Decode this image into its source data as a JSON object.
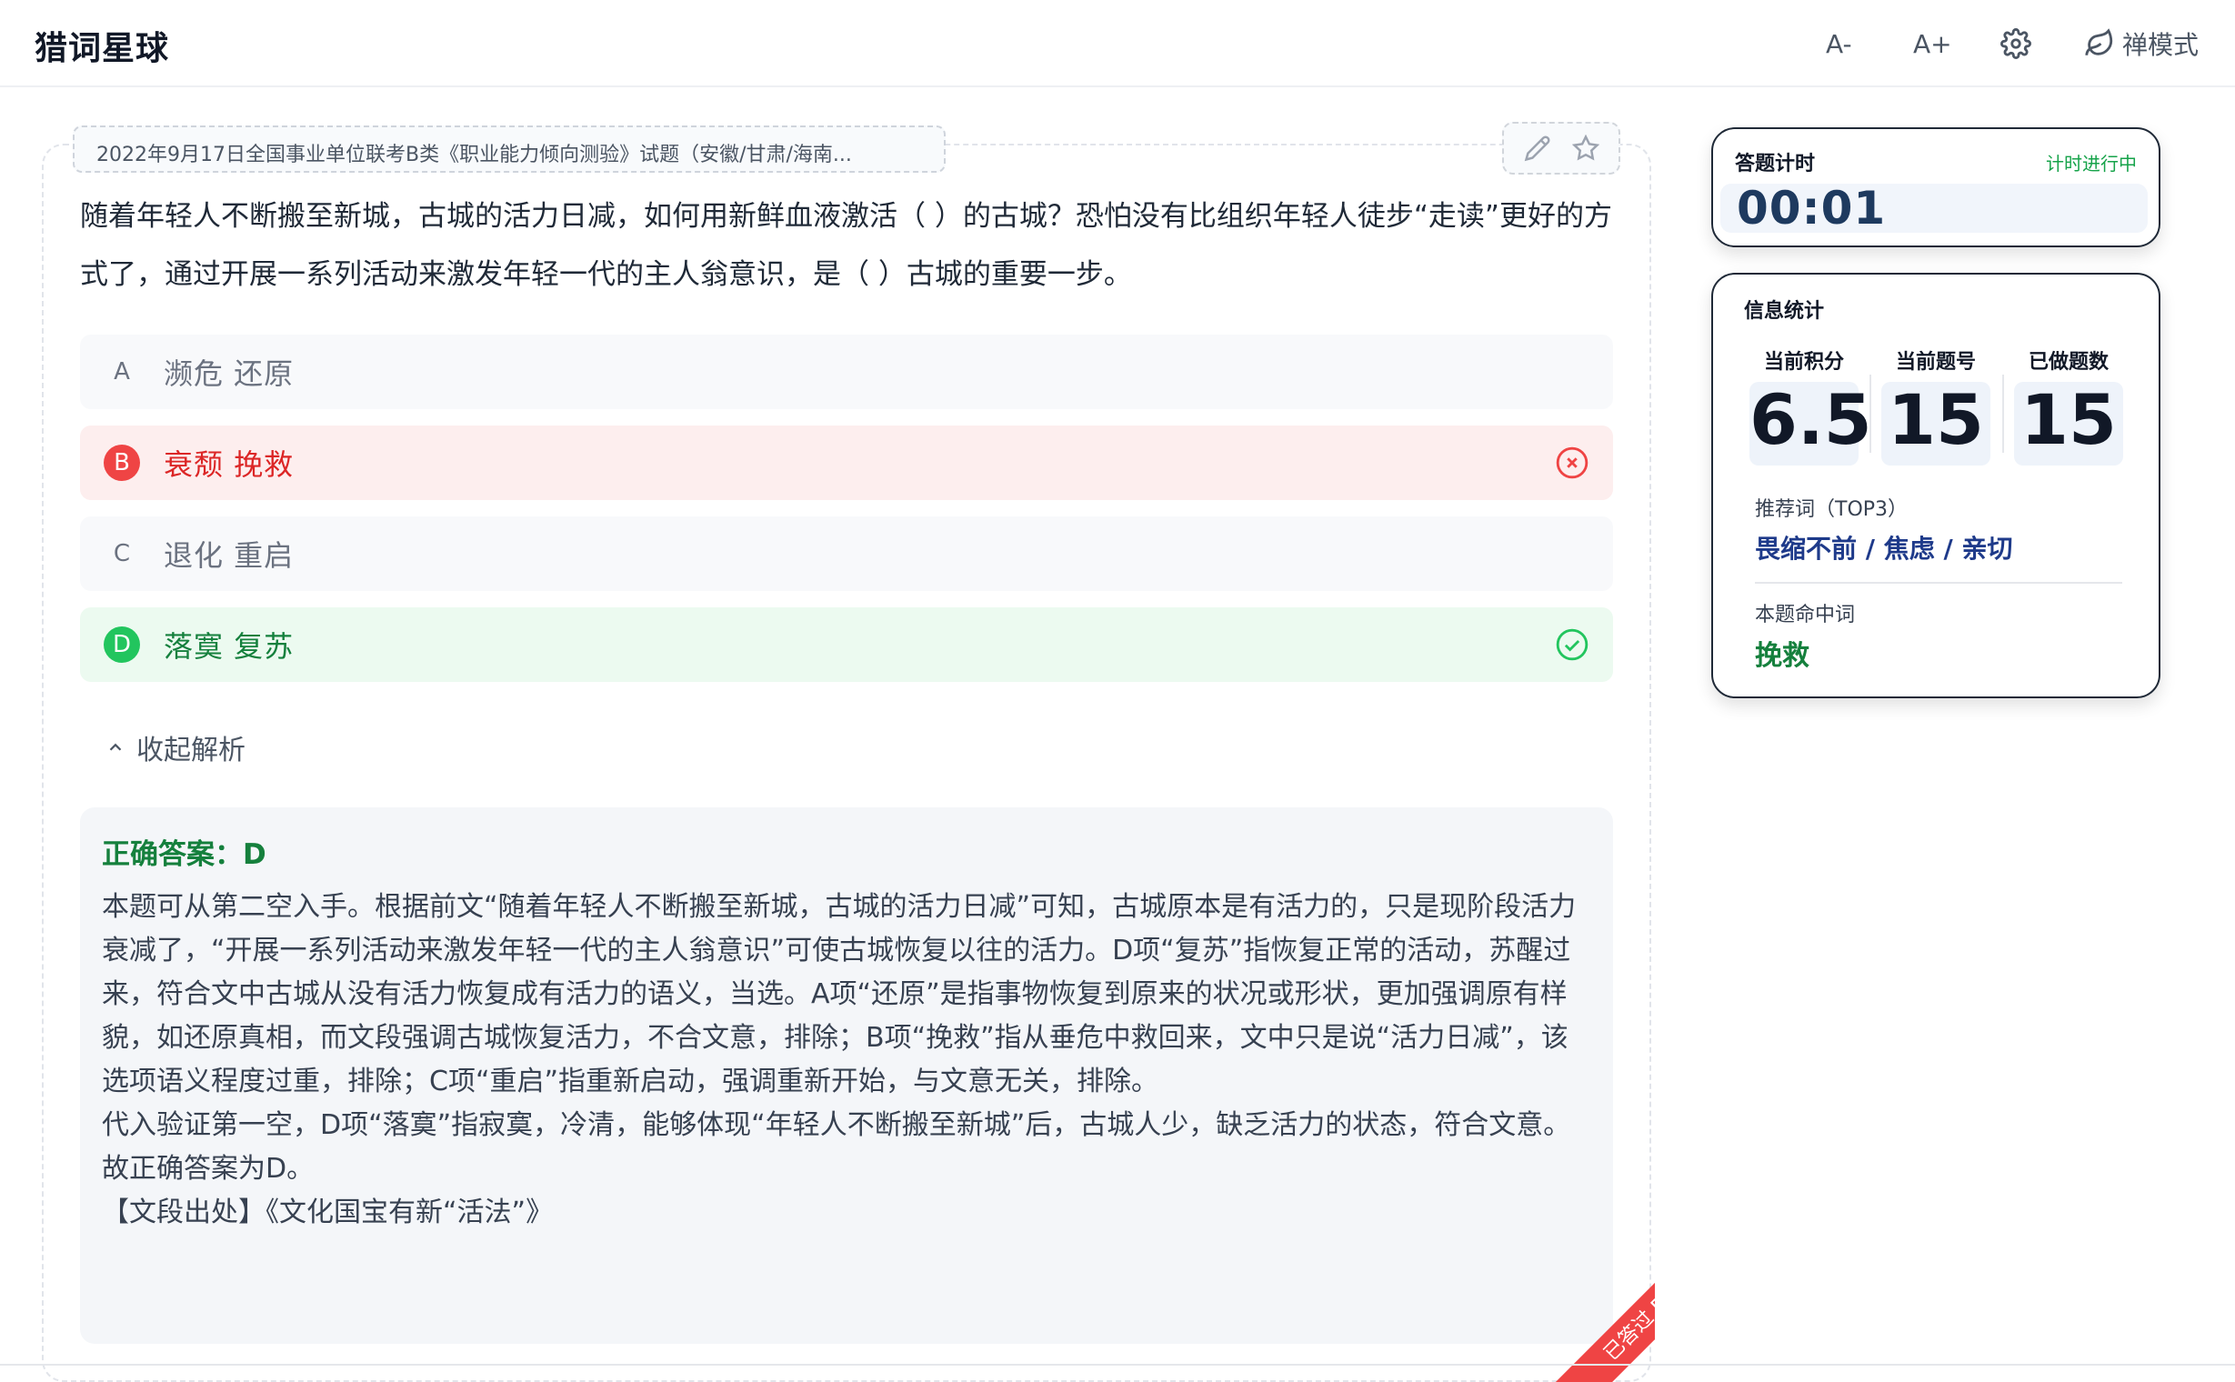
{
  "app": {
    "title": "猎词星球"
  },
  "toolbar": {
    "font_decrease": "A-",
    "font_increase": "A+",
    "settings_icon": "gear-icon",
    "zen_label": "禅模式",
    "zen_icon": "leaf-icon"
  },
  "question": {
    "source": "2022年9月17日全国事业单位联考B类《职业能力倾向测验》试题（安徽/甘肃/海南...",
    "stem": "随着年轻人不断搬至新城，古城的活力日减，如何用新鲜血液激活（ ）的古城？恐怕没有比组织年轻人徒步“走读”更好的方式了，通过开展一系列活动来激发年轻一代的主人翁意识，是（ ）古城的重要一步。",
    "options": [
      {
        "letter": "A",
        "text": "濒危 还原",
        "state": "normal"
      },
      {
        "letter": "B",
        "text": "衰颓 挽救",
        "state": "wrong"
      },
      {
        "letter": "C",
        "text": "退化 重启",
        "state": "normal"
      },
      {
        "letter": "D",
        "text": "落寞 复苏",
        "state": "correct"
      }
    ],
    "collapse_label": "收起解析",
    "ribbon": "已答过 B"
  },
  "explanation": {
    "answer_label": "正确答案：",
    "answer_value": "D",
    "paragraphs": [
      "本题可从第二空入手。根据前文“随着年轻人不断搬至新城，古城的活力日减”可知，古城原本是有活力的，只是现阶段活力衰减了，“开展一系列活动来激发年轻一代的主人翁意识”可使古城恢复以往的活力。D项“复苏”指恢复正常的活动，苏醒过来，符合文中古城从没有活力恢复成有活力的语义，当选。A项“还原”是指事物恢复到原来的状况或形状，更加强调原有样貌，如还原真相，而文段强调古城恢复活力，不合文意，排除；B项“挽救”指从垂危中救回来，文中只是说“活力日减”，该选项语义程度过重，排除；C项“重启”指重新启动，强调重新开始，与文意无关，排除。",
      "代入验证第一空，D项“落寞”指寂寞，冷清，能够体现“年轻人不断搬至新城”后，古城人少，缺乏活力的状态，符合文意。",
      "故正确答案为D。",
      "【文段出处】《文化国宝有新“活法”》"
    ]
  },
  "timer": {
    "label": "答题计时",
    "status": "计时进行中",
    "value": "00:01"
  },
  "stats": {
    "title": "信息统计",
    "score_label": "当前积分",
    "score_value": "6.5",
    "current_label": "当前题号",
    "current_value": "15",
    "done_label": "已做题数",
    "done_value": "15",
    "recommend_label": "推荐词（TOP3）",
    "recommend_words": "畏缩不前 / 焦虑 / 亲切",
    "hit_label": "本题命中词",
    "hit_word": "挽救"
  },
  "colors": {
    "wrong": "#ef4444",
    "correct": "#22c55e",
    "accent_green": "#15803d",
    "accent_blue": "#1e3a8a"
  }
}
